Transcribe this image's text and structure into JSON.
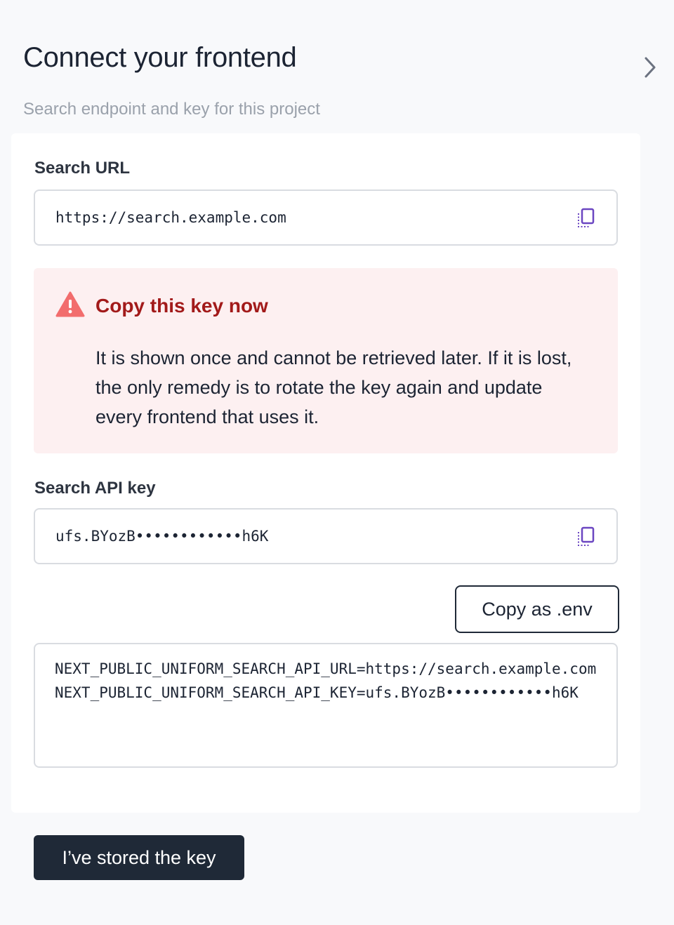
{
  "header": {
    "title": "Connect your frontend",
    "subtitle": "Search endpoint and key for this project",
    "next_icon": "chevron-right-icon"
  },
  "search_url": {
    "label": "Search URL",
    "value": "https://search.example.com",
    "copy_icon": "copy-icon"
  },
  "warning": {
    "icon": "warning-triangle-icon",
    "title": "Copy this key now",
    "body": "It is shown once and cannot be retrieved later. If it is lost, the only remedy is to rotate the key again and update every frontend that uses it."
  },
  "api_key": {
    "label": "Search API key",
    "value": "ufs.BYozB••••••••••••h6K",
    "copy_icon": "copy-icon"
  },
  "env": {
    "button_label": "Copy as .env",
    "content": "NEXT_PUBLIC_UNIFORM_SEARCH_API_URL=https://search.example.com\nNEXT_PUBLIC_UNIFORM_SEARCH_API_KEY=ufs.BYozB••••••••••••h6K"
  },
  "footer": {
    "confirm_label": "I’ve stored the key"
  },
  "colors": {
    "accent_icon": "#6b46c1",
    "warning_red": "#a21a1a",
    "warning_bg": "#fdf0f1",
    "primary_button_bg": "#1f2937"
  }
}
